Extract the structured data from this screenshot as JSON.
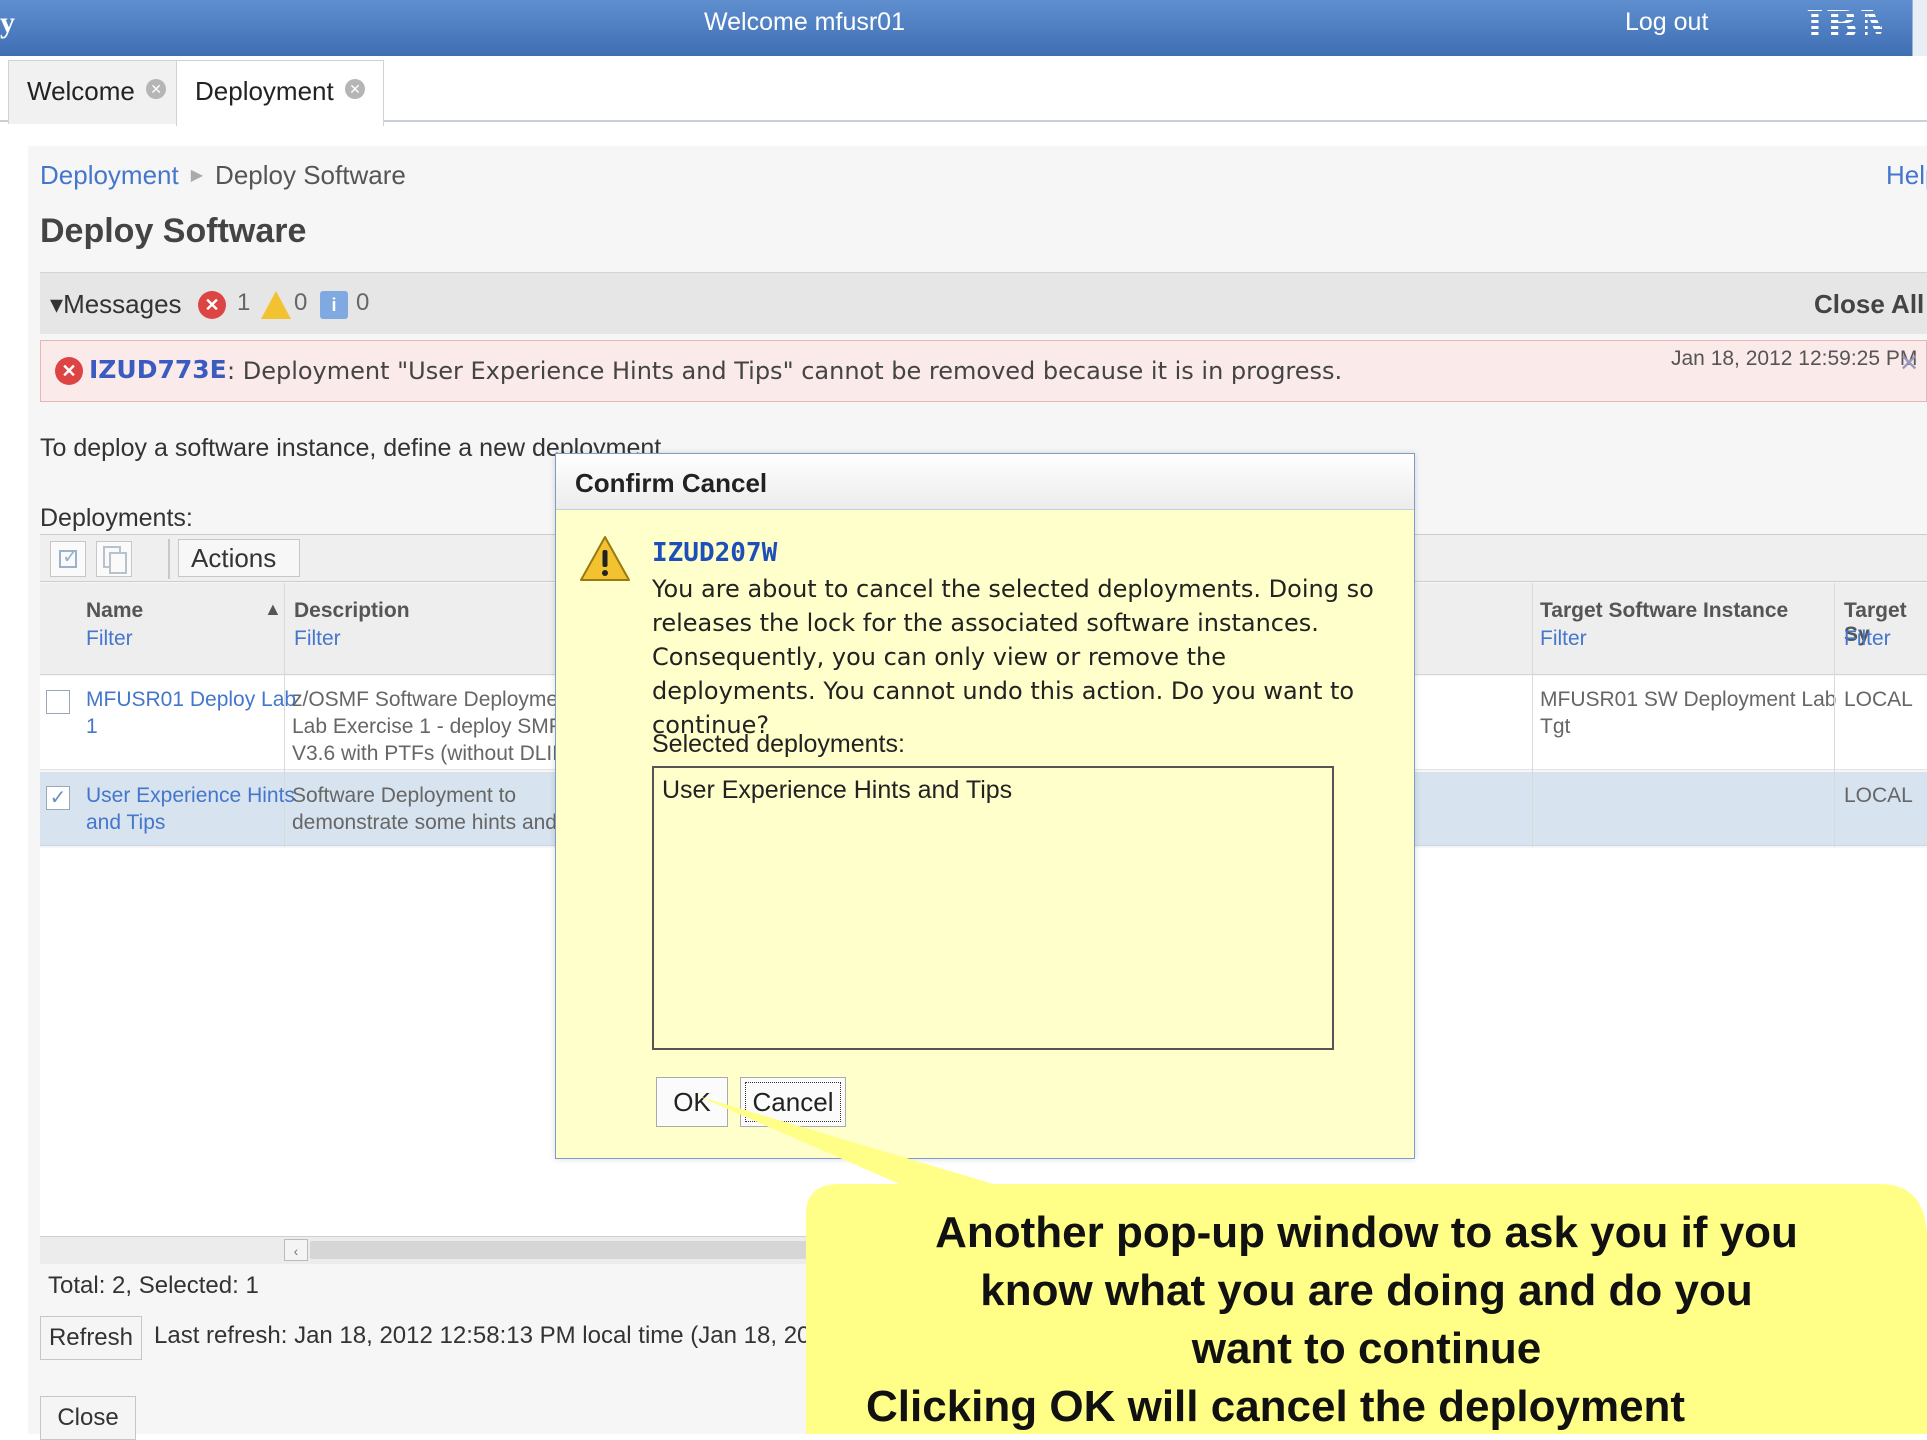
{
  "banner": {
    "brand_fragment": "y",
    "welcome": "Welcome mfusr01",
    "logout": "Log out",
    "logo": "IBM"
  },
  "tabs": [
    {
      "label": "Welcome",
      "close_icon": "close-circle-icon"
    },
    {
      "label": "Deployment",
      "close_icon": "close-circle-icon"
    }
  ],
  "breadcrumb": {
    "root": "Deployment",
    "current": "Deploy Software"
  },
  "help": "Help",
  "page_title": "Deploy Software",
  "messages": {
    "label": "Messages",
    "error_count": "1",
    "warning_count": "0",
    "info_count": "0",
    "close_all": "Close All",
    "items": [
      {
        "code": "IZUD773E",
        "text": ": Deployment \"User Experience Hints and Tips\" cannot be removed because it is in progress.",
        "date": "Jan 18, 2012 12:59:25 PM"
      }
    ]
  },
  "intro_text": "To deploy a software instance, define a new deployment.",
  "deployments_label": "Deployments:",
  "toolbar": {
    "actions_label": "Actions"
  },
  "table": {
    "columns": [
      {
        "name": "Name",
        "filter": "Filter"
      },
      {
        "name": "Description",
        "filter": "Filter"
      },
      {
        "name": "Target Software Instance",
        "filter": "Filter"
      },
      {
        "name": "Target Sy",
        "filter": "Filter"
      }
    ],
    "rows": [
      {
        "checked": false,
        "name_l1": "MFUSR01 Deploy Lab",
        "name_l2": "1",
        "desc_l1": "z/OSMF Software Deployment",
        "desc_l2": "Lab Exercise 1 - deploy SMP/E",
        "desc_l3": "V3.6 with PTFs (without DLIBs)",
        "target_l1": "MFUSR01 SW Deployment Lab",
        "target_l2": "Tgt",
        "system": "LOCAL"
      },
      {
        "checked": true,
        "name_l1": "User Experience Hints",
        "name_l2": "and Tips",
        "desc_l1": "Software Deployment to",
        "desc_l2": "demonstrate some hints and tips",
        "system": "LOCAL"
      }
    ],
    "totals": "Total: 2, Selected: 1"
  },
  "footer": {
    "refresh_label": "Refresh",
    "last_refresh": "Last refresh: Jan 18, 2012 12:58:13 PM local time (Jan 18, 2012",
    "close_label": "Close"
  },
  "dialog": {
    "title": "Confirm Cancel",
    "code": "IZUD207W",
    "message": "You are about to cancel the selected deployments. Doing so releases the lock for the associated software instances. Consequently, you can only view or remove the deployments. You cannot undo this action. Do you want to continue?",
    "selected_label": "Selected deployments:",
    "selected_items": [
      "User Experience Hints and Tips"
    ],
    "ok_label": "OK",
    "cancel_label": "Cancel"
  },
  "callout": {
    "line1": "Another pop-up window to ask you if you",
    "line2": "know what you are doing and do you",
    "line3": "want to continue",
    "line4": "Clicking OK will cancel the deployment"
  },
  "colors": {
    "banner": "#4a7cc0",
    "link": "#4477cc",
    "error": "#dd4444",
    "dialog_bg": "#ffffcc",
    "callout_bg": "#ffff88",
    "selected_row": "#d7e3ee"
  }
}
